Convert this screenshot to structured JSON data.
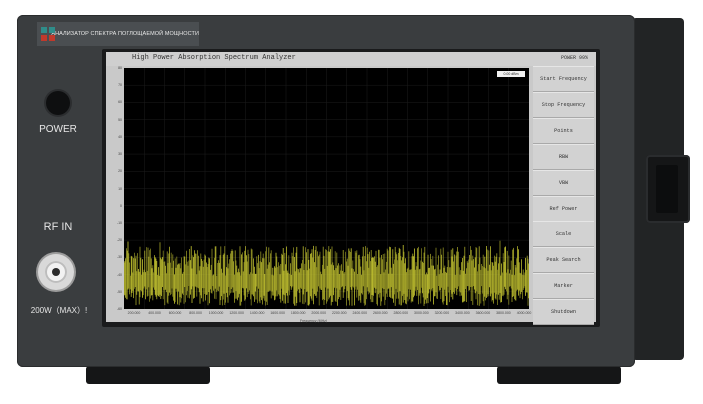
{
  "device": {
    "brand_text": "АНАЛИЗАТОР СПЕКТРА ПОГЛОЩАЕМОЙ МОЩНОСТИ",
    "power_label": "POWER",
    "rf_in_label": "RF IN",
    "max_power_label": "200W（MAX）!"
  },
  "screen": {
    "app_title": "High Power Absorption Spectrum Analyzer",
    "status": "POWER  99%",
    "legend": "0.00 dBm",
    "x_axis_label": "Frequency (MHz)",
    "y_ticks": [
      "80",
      "70",
      "60",
      "50",
      "40",
      "30",
      "20",
      "10",
      "0",
      "-10",
      "-20",
      "-30",
      "-40",
      "-50",
      "-60"
    ],
    "x_ticks": [
      "200.000",
      "400.000",
      "600.000",
      "800.000",
      "1000.000",
      "1200.000",
      "1400.000",
      "1600.000",
      "1800.000",
      "2000.000",
      "2200.000",
      "2400.000",
      "2600.000",
      "2800.000",
      "3000.000",
      "3200.000",
      "3400.000",
      "3600.000",
      "3800.000",
      "4000.000"
    ],
    "softkeys": [
      "Start Frequency",
      "Stop Frequency",
      "Points",
      "RBW",
      "VBW",
      "Ref Power",
      "Scale",
      "Peak Search",
      "Marker",
      "Shutdown"
    ]
  },
  "colors": {
    "trace": "#c8c832",
    "chassis": "#3a3d3f",
    "plot_background": "#000000"
  }
}
